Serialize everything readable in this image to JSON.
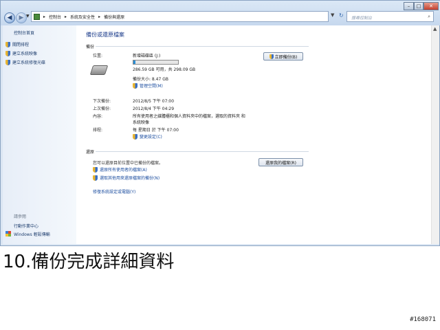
{
  "addressbar": {
    "breadcrumbs": [
      "控制台",
      "系統及安全性",
      "備份與還原"
    ],
    "search_placeholder": "搜尋控制台"
  },
  "sidebar": {
    "home": "控制台首頁",
    "links": [
      "關閉排程",
      "建立系統映像",
      "建立系統修復光碟"
    ],
    "see_also": "請參閱",
    "bottom_links": [
      "行動作業中心",
      "Windows 輕鬆傳輸"
    ]
  },
  "main": {
    "title": "備份或還原檔案",
    "backup": {
      "section_label": "備份",
      "location_label": "位置:",
      "location_value": "新增磁碟區 (J:)",
      "disk_usage": "286.59 GB 可用，共 298.09 GB",
      "disk_used_fraction": 0.04,
      "backup_size": "備份大小: 8.47 GB",
      "manage_space_link": "管理空間(M)",
      "backup_now_button": "立即備份(B)",
      "next_backup_label": "下次備份:",
      "next_backup_value": "2012/8/5 下午 07:00",
      "last_backup_label": "上次備份:",
      "last_backup_value": "2012/8/4 下午 04:29",
      "contents_label": "內容:",
      "contents_value_line1": "所有使用者之媒體櫃和個人資料夾中的檔案，選取的資料夾 和",
      "contents_value_line2": "系統映像",
      "schedule_label": "排程:",
      "schedule_value": "每 星期日 於 下午 07:00",
      "change_settings_link": "變更設定(C)"
    },
    "restore": {
      "section_label": "還原",
      "description": "您可以還原目前位置中已備份的檔案。",
      "restore_my_files_button": "還原我的檔案(R)",
      "restore_all_users_link": "還原所有使用者的檔案(A)",
      "select_other_backup_link": "選取其他用來還原檔案的備份(N)",
      "recover_system_link": "修復系統設定或電腦(Y)"
    }
  },
  "caption": "10.備份完成詳細資料",
  "watermark": "#168071"
}
